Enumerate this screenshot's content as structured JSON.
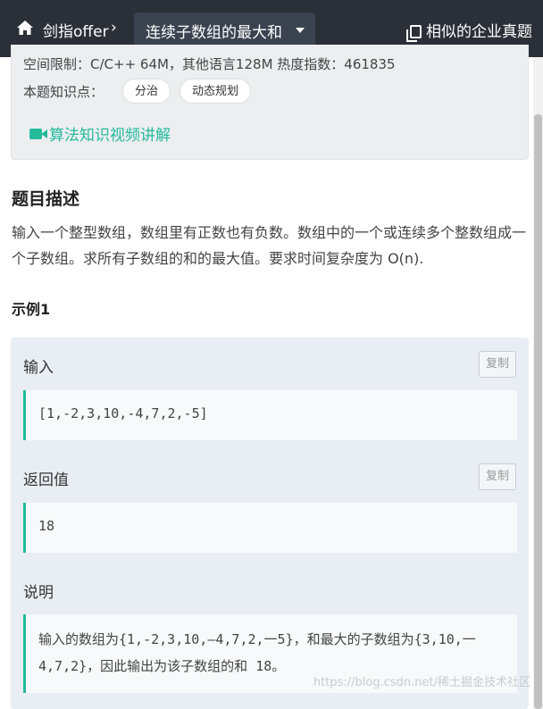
{
  "topbar": {
    "breadcrumb_label": "剑指offer",
    "breadcrumb_sep": "›",
    "problem_title": "连续子数组的最大和",
    "similar_label": "相似的企业真题"
  },
  "info": {
    "limits_line": "空间限制：C/C++ 64M，其他语言128M   热度指数：461835",
    "knowledge_label": "本题知识点：",
    "tags": [
      "分治",
      "动态规划"
    ],
    "video_label": "算法知识视频讲解"
  },
  "description": {
    "heading": "题目描述",
    "text": "输入一个整型数组，数组里有正数也有负数。数组中的一个或连续多个整数组成一个子数组。求所有子数组的和的最大值。要求时间复杂度为 O(n)."
  },
  "example": {
    "heading": "示例1",
    "input_label": "输入",
    "input_value": "[1,-2,3,10,-4,7,2,-5]",
    "output_label": "返回值",
    "output_value": "18",
    "copy_label": "复制",
    "explain_label": "说明",
    "explain_text": "输入的数组为{1,-2,3,10,—4,7,2,一5}，和最大的子数组为{3,10,一4,7,2}，因此输出为该子数组的和 18。"
  },
  "watermark": "https://blog.csdn.net/稀土掘金技术社区",
  "colors": {
    "topbar": "#2b3038",
    "accent": "#25bb9b"
  }
}
